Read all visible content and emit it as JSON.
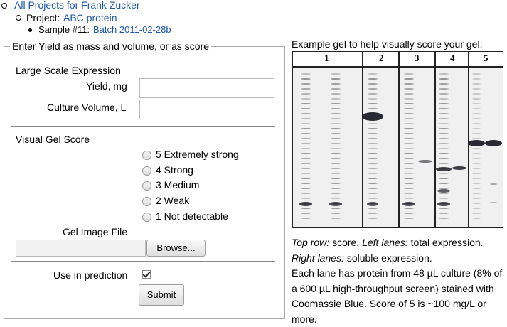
{
  "breadcrumb": {
    "projects_link": "All Projects for Frank Zucker",
    "project_label": "Project:",
    "project_link": "ABC protein",
    "sample_label": "Sample #11:",
    "sample_link": "Batch 2011-02-28b"
  },
  "form": {
    "legend": "Enter Yield as mass and volume, or as score",
    "large_scale_heading": "Large Scale Expression",
    "yield_label": "Yield, mg",
    "yield_value": "",
    "volume_label": "Culture Volume, L",
    "volume_value": "",
    "visual_gel_heading": "Visual Gel Score",
    "scores": [
      "5 Extremely strong",
      "4 Strong",
      "3 Medium",
      "2 Weak",
      "1 Not detectable"
    ],
    "gel_image_label": "Gel Image File",
    "browse_label": "Browse...",
    "use_in_prediction_label": "Use in prediction",
    "use_in_prediction_checked": true,
    "submit_label": "Submit"
  },
  "gel": {
    "title": "Example gel to help visually score your gel:",
    "lane_numbers": [
      "1",
      "2",
      "3",
      "4",
      "5"
    ],
    "caption": {
      "top_row_label": "Top row:",
      "top_row_text": " score. ",
      "left_lanes_label": "Left lanes:",
      "left_lanes_text": " total expression.",
      "right_lanes_label": "Right lanes:",
      "right_lanes_text": " soluble expression.",
      "body": "Each lane has protein from 48 µL culture (8% of a 600 µL high-throughput screen) stained with Coomassie Blue. Score of 5 is ~100 mg/L or more."
    }
  }
}
